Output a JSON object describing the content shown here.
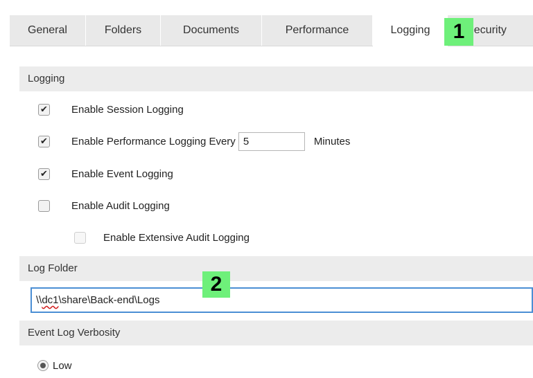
{
  "tabs": [
    {
      "label": "General",
      "active": false
    },
    {
      "label": "Folders",
      "active": false
    },
    {
      "label": "Documents",
      "active": false
    },
    {
      "label": "Performance",
      "active": false
    },
    {
      "label": "Logging",
      "active": true
    },
    {
      "label": "Security",
      "active": false
    }
  ],
  "logging": {
    "header": "Logging",
    "session": {
      "label": "Enable Session Logging",
      "checked": true
    },
    "performance": {
      "label_prefix": "Enable Performance Logging Every",
      "interval": "5",
      "label_suffix": "Minutes",
      "checked": true
    },
    "event": {
      "label": "Enable Event Logging",
      "checked": true
    },
    "audit": {
      "label": "Enable Audit Logging",
      "checked": false
    },
    "extensive_audit": {
      "label": "Enable Extensive Audit Logging",
      "checked": false,
      "disabled": true
    }
  },
  "log_folder": {
    "header": "Log Folder",
    "path_prefix": "\\\\",
    "path_misspelled": "dc1",
    "path_rest": "\\share\\Back-end\\Logs"
  },
  "verbosity": {
    "header": "Event Log Verbosity",
    "options": [
      {
        "label": "Low",
        "selected": true
      }
    ]
  },
  "callouts": [
    "1",
    "2"
  ],
  "colors": {
    "callout": "#6ef07a",
    "input_focus_border": "#4a8ed4",
    "section_header_bg": "#ececec"
  }
}
